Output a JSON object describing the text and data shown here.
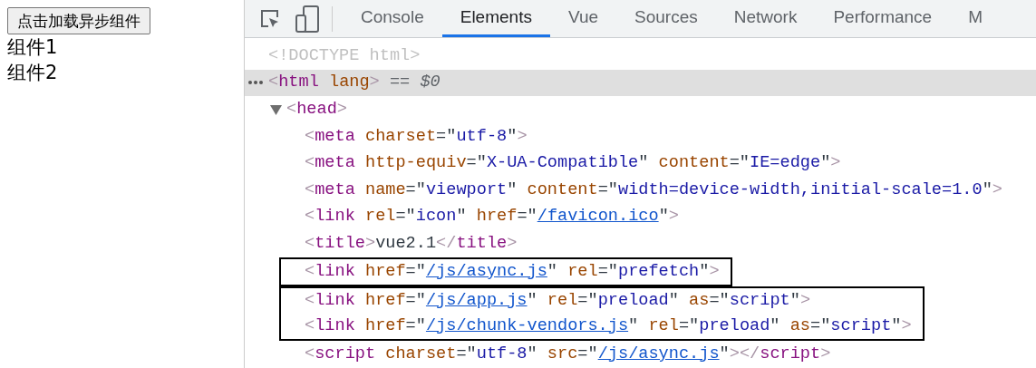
{
  "page": {
    "button": "点击加载异步组件",
    "items": [
      "组件1",
      "组件2"
    ]
  },
  "devtools": {
    "tabs": [
      {
        "label": "Console",
        "selected": false
      },
      {
        "label": "Elements",
        "selected": true
      },
      {
        "label": "Vue",
        "selected": false
      },
      {
        "label": "Sources",
        "selected": false
      },
      {
        "label": "Network",
        "selected": false
      },
      {
        "label": "Performance",
        "selected": false
      },
      {
        "label": "M",
        "selected": false
      }
    ],
    "dom_tree": [
      {
        "kind": "node",
        "selected": false,
        "tokens": [
          {
            "kind": "doctype",
            "text": "<!DOCTYPE html>"
          }
        ]
      },
      {
        "kind": "node",
        "selected": true,
        "tokens": [
          {
            "kind": "bracket",
            "text": "<"
          },
          {
            "kind": "tag",
            "text": "html"
          },
          {
            "kind": "attr",
            "text": " lang"
          },
          {
            "kind": "bracket",
            "text": ">"
          },
          {
            "kind": "note",
            "text": " == "
          },
          {
            "kind": "var",
            "text": "$0"
          }
        ],
        "children": [
          {
            "kind": "node",
            "selected": false,
            "expanded": true,
            "tokens": [
              {
                "kind": "bracket",
                "text": "<"
              },
              {
                "kind": "tag",
                "text": "head"
              },
              {
                "kind": "bracket",
                "text": ">"
              }
            ],
            "children": [
              {
                "kind": "node",
                "selected": false,
                "tokens": [
                  {
                    "kind": "bracket",
                    "text": "<"
                  },
                  {
                    "kind": "tag",
                    "text": "meta"
                  },
                  {
                    "kind": "attr",
                    "text": " charset"
                  },
                  {
                    "kind": "punct",
                    "text": "=\""
                  },
                  {
                    "kind": "value",
                    "text": "utf-8"
                  },
                  {
                    "kind": "punct",
                    "text": "\""
                  },
                  {
                    "kind": "bracket",
                    "text": ">"
                  }
                ]
              },
              {
                "kind": "node",
                "selected": false,
                "tokens": [
                  {
                    "kind": "bracket",
                    "text": "<"
                  },
                  {
                    "kind": "tag",
                    "text": "meta"
                  },
                  {
                    "kind": "attr",
                    "text": " http-equiv"
                  },
                  {
                    "kind": "punct",
                    "text": "=\""
                  },
                  {
                    "kind": "value",
                    "text": "X-UA-Compatible"
                  },
                  {
                    "kind": "punct",
                    "text": "\""
                  },
                  {
                    "kind": "attr",
                    "text": " content"
                  },
                  {
                    "kind": "punct",
                    "text": "=\""
                  },
                  {
                    "kind": "value",
                    "text": "IE=edge"
                  },
                  {
                    "kind": "punct",
                    "text": "\""
                  },
                  {
                    "kind": "bracket",
                    "text": ">"
                  }
                ]
              },
              {
                "kind": "node",
                "selected": false,
                "tokens": [
                  {
                    "kind": "bracket",
                    "text": "<"
                  },
                  {
                    "kind": "tag",
                    "text": "meta"
                  },
                  {
                    "kind": "attr",
                    "text": " name"
                  },
                  {
                    "kind": "punct",
                    "text": "=\""
                  },
                  {
                    "kind": "value",
                    "text": "viewport"
                  },
                  {
                    "kind": "punct",
                    "text": "\""
                  },
                  {
                    "kind": "attr",
                    "text": " content"
                  },
                  {
                    "kind": "punct",
                    "text": "=\""
                  },
                  {
                    "kind": "value",
                    "text": "width=device-width,initial-scale=1.0"
                  },
                  {
                    "kind": "punct",
                    "text": "\""
                  },
                  {
                    "kind": "bracket",
                    "text": ">"
                  }
                ]
              },
              {
                "kind": "node",
                "selected": false,
                "tokens": [
                  {
                    "kind": "bracket",
                    "text": "<"
                  },
                  {
                    "kind": "tag",
                    "text": "link"
                  },
                  {
                    "kind": "attr",
                    "text": " rel"
                  },
                  {
                    "kind": "punct",
                    "text": "=\""
                  },
                  {
                    "kind": "value",
                    "text": "icon"
                  },
                  {
                    "kind": "punct",
                    "text": "\""
                  },
                  {
                    "kind": "attr",
                    "text": " href"
                  },
                  {
                    "kind": "punct",
                    "text": "=\""
                  },
                  {
                    "kind": "link",
                    "text": "/favicon.ico"
                  },
                  {
                    "kind": "punct",
                    "text": "\""
                  },
                  {
                    "kind": "bracket",
                    "text": ">"
                  }
                ]
              },
              {
                "kind": "node",
                "selected": false,
                "tokens": [
                  {
                    "kind": "bracket",
                    "text": "<"
                  },
                  {
                    "kind": "tag",
                    "text": "title"
                  },
                  {
                    "kind": "bracket",
                    "text": ">"
                  },
                  {
                    "kind": "text",
                    "text": "vue2.1"
                  },
                  {
                    "kind": "bracket",
                    "text": "</"
                  },
                  {
                    "kind": "tag",
                    "text": "title"
                  },
                  {
                    "kind": "bracket",
                    "text": ">"
                  }
                ]
              },
              {
                "kind": "frame",
                "lines": [
                  {
                    "kind": "node",
                    "selected": false,
                    "tokens": [
                      {
                        "kind": "bracket",
                        "text": "<"
                      },
                      {
                        "kind": "tag",
                        "text": "link"
                      },
                      {
                        "kind": "attr",
                        "text": " href"
                      },
                      {
                        "kind": "punct",
                        "text": "=\""
                      },
                      {
                        "kind": "link",
                        "text": "/js/async.js"
                      },
                      {
                        "kind": "punct",
                        "text": "\""
                      },
                      {
                        "kind": "attr",
                        "text": " rel"
                      },
                      {
                        "kind": "punct",
                        "text": "=\""
                      },
                      {
                        "kind": "value",
                        "text": "prefetch"
                      },
                      {
                        "kind": "punct",
                        "text": "\""
                      },
                      {
                        "kind": "bracket",
                        "text": ">"
                      }
                    ]
                  }
                ]
              },
              {
                "kind": "frame",
                "lines": [
                  {
                    "kind": "node",
                    "selected": false,
                    "tokens": [
                      {
                        "kind": "bracket",
                        "text": "<"
                      },
                      {
                        "kind": "tag",
                        "text": "link"
                      },
                      {
                        "kind": "attr",
                        "text": " href"
                      },
                      {
                        "kind": "punct",
                        "text": "=\""
                      },
                      {
                        "kind": "link",
                        "text": "/js/app.js"
                      },
                      {
                        "kind": "punct",
                        "text": "\""
                      },
                      {
                        "kind": "attr",
                        "text": " rel"
                      },
                      {
                        "kind": "punct",
                        "text": "=\""
                      },
                      {
                        "kind": "value",
                        "text": "preload"
                      },
                      {
                        "kind": "punct",
                        "text": "\""
                      },
                      {
                        "kind": "attr",
                        "text": " as"
                      },
                      {
                        "kind": "punct",
                        "text": "=\""
                      },
                      {
                        "kind": "value",
                        "text": "script"
                      },
                      {
                        "kind": "punct",
                        "text": "\""
                      },
                      {
                        "kind": "bracket",
                        "text": ">"
                      }
                    ]
                  },
                  {
                    "kind": "node",
                    "selected": false,
                    "tokens": [
                      {
                        "kind": "bracket",
                        "text": "<"
                      },
                      {
                        "kind": "tag",
                        "text": "link"
                      },
                      {
                        "kind": "attr",
                        "text": " href"
                      },
                      {
                        "kind": "punct",
                        "text": "=\""
                      },
                      {
                        "kind": "link",
                        "text": "/js/chunk-vendors.js"
                      },
                      {
                        "kind": "punct",
                        "text": "\""
                      },
                      {
                        "kind": "attr",
                        "text": " rel"
                      },
                      {
                        "kind": "punct",
                        "text": "=\""
                      },
                      {
                        "kind": "value",
                        "text": "preload"
                      },
                      {
                        "kind": "punct",
                        "text": "\""
                      },
                      {
                        "kind": "attr",
                        "text": " as"
                      },
                      {
                        "kind": "punct",
                        "text": "=\""
                      },
                      {
                        "kind": "value",
                        "text": "script"
                      },
                      {
                        "kind": "punct",
                        "text": "\""
                      },
                      {
                        "kind": "bracket",
                        "text": ">"
                      }
                    ]
                  }
                ]
              },
              {
                "kind": "node",
                "selected": false,
                "tokens": [
                  {
                    "kind": "bracket",
                    "text": "<"
                  },
                  {
                    "kind": "tag",
                    "text": "script"
                  },
                  {
                    "kind": "attr",
                    "text": " charset"
                  },
                  {
                    "kind": "punct",
                    "text": "=\""
                  },
                  {
                    "kind": "value",
                    "text": "utf-8"
                  },
                  {
                    "kind": "punct",
                    "text": "\""
                  },
                  {
                    "kind": "attr",
                    "text": " src"
                  },
                  {
                    "kind": "punct",
                    "text": "=\""
                  },
                  {
                    "kind": "link",
                    "text": "/js/async.js"
                  },
                  {
                    "kind": "punct",
                    "text": "\""
                  },
                  {
                    "kind": "bracket",
                    "text": "></"
                  },
                  {
                    "kind": "tag",
                    "text": "script"
                  },
                  {
                    "kind": "bracket",
                    "text": ">"
                  }
                ]
              }
            ]
          }
        ]
      }
    ]
  }
}
